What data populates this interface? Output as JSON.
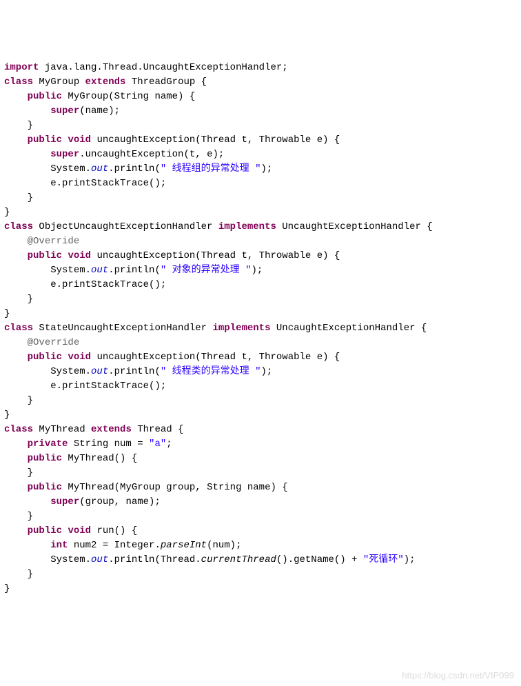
{
  "code": {
    "l1": {
      "a": "import",
      "b": " java.lang.Thread.UncaughtExceptionHandler;"
    },
    "l2": {
      "a": "class",
      "b": " MyGroup ",
      "c": "extends",
      "d": " ThreadGroup {"
    },
    "l3": {
      "a": "public",
      "b": " MyGroup(String name) {"
    },
    "l4": {
      "a": "super",
      "b": "(name);"
    },
    "l5": "}",
    "l6": {
      "a": "public",
      "b": " ",
      "c": "void",
      "d": " uncaughtException(Thread t, Throwable e) {"
    },
    "l7": {
      "a": "super",
      "b": ".uncaughtException(t, e);"
    },
    "l8": {
      "a": "System.",
      "b": "out",
      "c": ".println(",
      "d": "\" 线程组的异常处理 \"",
      "e": ");"
    },
    "l9": "e.printStackTrace();",
    "l10": "}",
    "l11": "}",
    "l12": {
      "a": "class",
      "b": " ObjectUncaughtExceptionHandler ",
      "c": "implements",
      "d": " UncaughtExceptionHandler {"
    },
    "l13": "@Override",
    "l14": {
      "a": "public",
      "b": " ",
      "c": "void",
      "d": " uncaughtException(Thread t, Throwable e) {"
    },
    "l15": {
      "a": "System.",
      "b": "out",
      "c": ".println(",
      "d": "\" 对象的异常处理 \"",
      "e": ");"
    },
    "l16": "e.printStackTrace();",
    "l17": "}",
    "l18": "}",
    "l19": {
      "a": "class",
      "b": " StateUncaughtExceptionHandler ",
      "c": "implements",
      "d": " UncaughtExceptionHandler {"
    },
    "l20": "@Override",
    "l21": {
      "a": "public",
      "b": " ",
      "c": "void",
      "d": " uncaughtException(Thread t, Throwable e) {"
    },
    "l22": {
      "a": "System.",
      "b": "out",
      "c": ".println(",
      "d": "\" 线程类的异常处理 \"",
      "e": ");"
    },
    "l23": "e.printStackTrace();",
    "l24": "}",
    "l25": "}",
    "l26": {
      "a": "class",
      "b": " MyThread ",
      "c": "extends",
      "d": " Thread {"
    },
    "l27": {
      "a": "private",
      "b": " String num = ",
      "c": "\"a\"",
      "d": ";"
    },
    "l28": {
      "a": "public",
      "b": " MyThread() {"
    },
    "l29": "}",
    "l30": {
      "a": "public",
      "b": " MyThread(MyGroup group, String name) {"
    },
    "l31": {
      "a": "super",
      "b": "(group, name);"
    },
    "l32": "}",
    "l33": {
      "a": "public",
      "b": " ",
      "c": "void",
      "d": " run() {"
    },
    "l34": {
      "a": "int",
      "b": " num2 = Integer.",
      "c": "parseInt",
      "d": "(num);"
    },
    "l35": {
      "a": "System.",
      "b": "out",
      "c": ".println(Thread.",
      "d": "currentThread",
      "e": "().getName() + ",
      "f": "\"死循环\"",
      "g": ");"
    },
    "l36": "}",
    "l37": "}"
  },
  "watermark": "https://blog.csdn.net/VIP099"
}
